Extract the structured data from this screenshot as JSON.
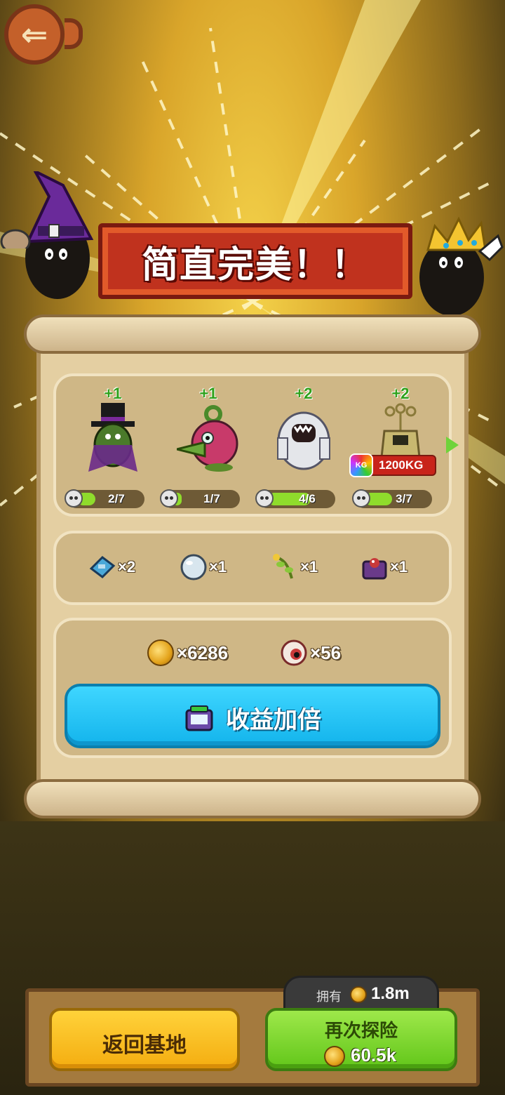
{
  "title": "简直完美！！",
  "monsters": [
    {
      "plus": "+1",
      "progress": "2/7",
      "fill": 0.286
    },
    {
      "plus": "+1",
      "progress": "1/7",
      "fill": 0.143
    },
    {
      "plus": "+2",
      "progress": "4/6",
      "fill": 0.667
    },
    {
      "plus": "+2",
      "progress": "3/7",
      "fill": 0.429
    }
  ],
  "weight_badge": {
    "icon_text": "KG",
    "value": "1200KG"
  },
  "items": [
    {
      "icon": "blueprint-icon",
      "count": "×2"
    },
    {
      "icon": "pearl-icon",
      "count": "×1"
    },
    {
      "icon": "herb-icon",
      "count": "×1"
    },
    {
      "icon": "chest-icon",
      "count": "×1"
    }
  ],
  "resources": [
    {
      "icon": "coin-icon",
      "count": "×6286"
    },
    {
      "icon": "eyeball-icon",
      "count": "×56"
    }
  ],
  "double_button": {
    "label": "收益加倍",
    "icon": "tv-icon"
  },
  "owned": {
    "label": "拥有",
    "value": "1.8m"
  },
  "home_button": {
    "label": "返回基地"
  },
  "again_button": {
    "label": "再次探险",
    "cost": "60.5k"
  },
  "colors": {
    "accent_blue": "#13b4ec",
    "green": "#62c61a",
    "yellow": "#f4ad10",
    "banner_red": "#c0321e"
  }
}
